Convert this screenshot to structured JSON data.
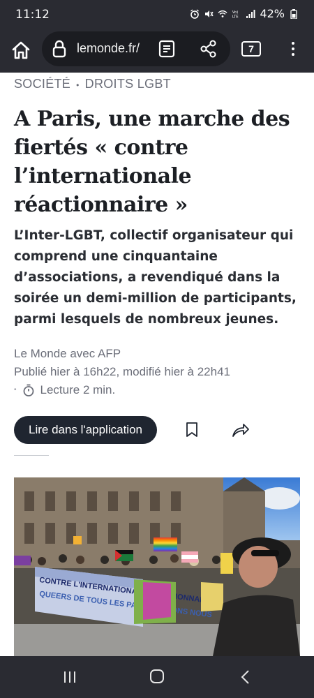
{
  "status_bar": {
    "time": "11:12",
    "battery": "42%",
    "icons": [
      "alarm-icon",
      "mute-icon",
      "wifi-icon",
      "volte-icon",
      "signal-icon",
      "battery-icon"
    ]
  },
  "browser": {
    "url": "lemonde.fr/",
    "tab_count": "7",
    "icons": [
      "home-icon",
      "lock-icon",
      "reader-mode-icon",
      "share-icon",
      "tabs-icon",
      "more-vert-icon"
    ]
  },
  "article": {
    "breadcrumb": {
      "section": "SOCIÉTÉ",
      "separator": "•",
      "subsection": "DROITS LGBT"
    },
    "headline": "A Paris, une marche des fiertés « contre l’internationale réactionnaire »",
    "standfirst": "L’Inter-LGBT, collectif organisateur qui comprend une cinquantaine d’associations, a revendiqué dans la soirée un demi-million de participants, parmi lesquels de nombreux jeunes.",
    "author": "Le Monde avec AFP",
    "published": "Publié hier à 16h22, modifié hier à 22h41",
    "reading_dot": "•",
    "reading_time": "Lecture 2 min.",
    "app_button": "Lire dans l'application",
    "photo_banner_line1": "CONTRE L'INTERNATIONALE RÉACTIONNAIRE",
    "photo_banner_line2": "QUEERS DE TOUS LES PAYS UNISSONS NOUS"
  },
  "colors": {
    "chrome": "#2a2b32",
    "url_pill": "#1b1c21",
    "headline": "#1c1f24",
    "meta": "#6b6e79",
    "button": "#1f2530"
  }
}
